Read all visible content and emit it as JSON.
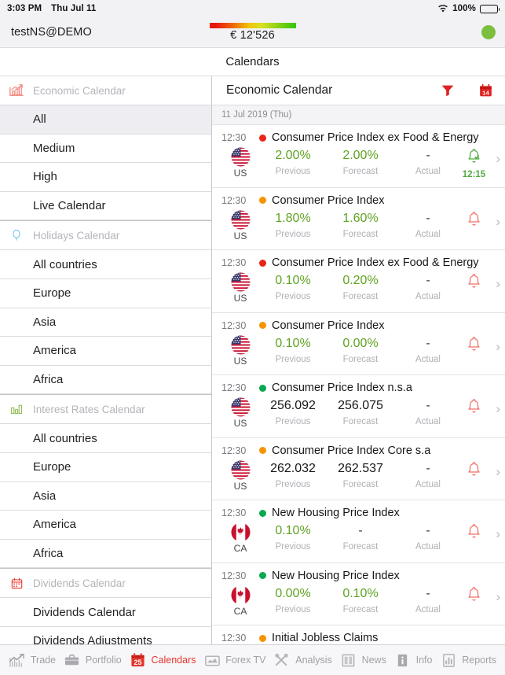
{
  "statusbar": {
    "time": "3:03 PM",
    "date": "Thu Jul 11",
    "battery_pct": "100%",
    "wifi_icon": "wifi-icon",
    "battery_icon": "battery-full-icon"
  },
  "accountbar": {
    "account": "testNS@DEMO",
    "equity": "€ 12'526",
    "equity_bar_icon": "equity-gradient-bar",
    "connection_icon": "connection-status-dot",
    "connection_color": "#7cbf3f"
  },
  "navbar": {
    "title": "Calendars"
  },
  "sidebar": {
    "sections": [
      {
        "label": "Economic Calendar",
        "icon": "economic-chart-icon",
        "icon_color": "#ef8278",
        "items": [
          {
            "label": "All",
            "selected": true
          },
          {
            "label": "Medium",
            "selected": false
          },
          {
            "label": "High",
            "selected": false
          },
          {
            "label": "Live Calendar",
            "selected": false
          }
        ]
      },
      {
        "label": "Holidays Calendar",
        "icon": "balloon-icon",
        "icon_color": "#6fc6ee",
        "items": [
          {
            "label": "All countries",
            "selected": false
          },
          {
            "label": "Europe",
            "selected": false
          },
          {
            "label": "Asia",
            "selected": false
          },
          {
            "label": "America",
            "selected": false
          },
          {
            "label": "Africa",
            "selected": false
          }
        ]
      },
      {
        "label": "Interest Rates Calendar",
        "icon": "bar-chart-icon",
        "icon_color": "#8cb84a",
        "items": [
          {
            "label": "All countries",
            "selected": false
          },
          {
            "label": "Europe",
            "selected": false
          },
          {
            "label": "Asia",
            "selected": false
          },
          {
            "label": "America",
            "selected": false
          },
          {
            "label": "Africa",
            "selected": false
          }
        ]
      },
      {
        "label": "Dividends Calendar",
        "icon": "calendar-icon",
        "icon_color": "#e8342b",
        "items": [
          {
            "label": "Dividends Calendar",
            "selected": false
          },
          {
            "label": "Dividends Adjustments",
            "selected": false
          }
        ]
      }
    ]
  },
  "main": {
    "title": "Economic Calendar",
    "actions": [
      {
        "name": "filter-icon",
        "label": "Filter"
      },
      {
        "name": "calendar-date-icon",
        "label": "14"
      }
    ],
    "date_header": "11 Jul 2019 (Thu)",
    "column_labels": {
      "previous": "Previous",
      "forecast": "Forecast",
      "actual": "Actual"
    },
    "events": [
      {
        "time": "12:30",
        "impact": "high",
        "impact_color": "#e8251a",
        "title": "Consumer Price Index ex Food & Energy",
        "country": "US",
        "flag": "us-flag-icon",
        "previous": "2.00%",
        "previous_style": "green",
        "forecast": "2.00%",
        "forecast_style": "green",
        "actual": "-",
        "actual_style": "dash",
        "bell": "bell-enabled-icon",
        "bell_color": "#4faa3f",
        "bell_time": "12:15"
      },
      {
        "time": "12:30",
        "impact": "medium",
        "impact_color": "#f79300",
        "title": "Consumer Price Index",
        "country": "US",
        "flag": "us-flag-icon",
        "previous": "1.80%",
        "previous_style": "green",
        "forecast": "1.60%",
        "forecast_style": "green",
        "actual": "-",
        "actual_style": "dash",
        "bell": "bell-icon",
        "bell_color": "#ef6e62",
        "bell_time": ""
      },
      {
        "time": "12:30",
        "impact": "high",
        "impact_color": "#e8251a",
        "title": "Consumer Price Index ex Food & Energy",
        "country": "US",
        "flag": "us-flag-icon",
        "previous": "0.10%",
        "previous_style": "green",
        "forecast": "0.20%",
        "forecast_style": "green",
        "actual": "-",
        "actual_style": "dash",
        "bell": "bell-icon",
        "bell_color": "#ef6e62",
        "bell_time": ""
      },
      {
        "time": "12:30",
        "impact": "medium",
        "impact_color": "#f79300",
        "title": "Consumer Price Index",
        "country": "US",
        "flag": "us-flag-icon",
        "previous": "0.10%",
        "previous_style": "green",
        "forecast": "0.00%",
        "forecast_style": "green",
        "actual": "-",
        "actual_style": "dash",
        "bell": "bell-icon",
        "bell_color": "#ef6e62",
        "bell_time": ""
      },
      {
        "time": "12:30",
        "impact": "low",
        "impact_color": "#0aa84f",
        "title": "Consumer Price Index n.s.a",
        "country": "US",
        "flag": "us-flag-icon",
        "previous": "256.092",
        "previous_style": "black",
        "forecast": "256.075",
        "forecast_style": "black",
        "actual": "-",
        "actual_style": "dash",
        "bell": "bell-icon",
        "bell_color": "#ef6e62",
        "bell_time": ""
      },
      {
        "time": "12:30",
        "impact": "medium",
        "impact_color": "#f79300",
        "title": "Consumer Price Index Core s.a",
        "country": "US",
        "flag": "us-flag-icon",
        "previous": "262.032",
        "previous_style": "black",
        "forecast": "262.537",
        "forecast_style": "black",
        "actual": "-",
        "actual_style": "dash",
        "bell": "bell-icon",
        "bell_color": "#ef6e62",
        "bell_time": ""
      },
      {
        "time": "12:30",
        "impact": "low",
        "impact_color": "#0aa84f",
        "title": "New Housing Price Index",
        "country": "CA",
        "flag": "ca-flag-icon",
        "previous": "0.10%",
        "previous_style": "green",
        "forecast": "-",
        "forecast_style": "dash",
        "actual": "-",
        "actual_style": "dash",
        "bell": "bell-icon",
        "bell_color": "#ef6e62",
        "bell_time": ""
      },
      {
        "time": "12:30",
        "impact": "low",
        "impact_color": "#0aa84f",
        "title": "New Housing Price Index",
        "country": "CA",
        "flag": "ca-flag-icon",
        "previous": "0.00%",
        "previous_style": "green",
        "forecast": "0.10%",
        "forecast_style": "green",
        "actual": "-",
        "actual_style": "dash",
        "bell": "bell-icon",
        "bell_color": "#ef6e62",
        "bell_time": ""
      }
    ],
    "partial_event": {
      "time": "12:30",
      "impact": "medium",
      "impact_color": "#f79300",
      "title": "Initial Jobless Claims"
    }
  },
  "tabbar": {
    "items": [
      {
        "label": "Trade",
        "icon": "trade-chart-icon",
        "active": false
      },
      {
        "label": "Portfolio",
        "icon": "briefcase-icon",
        "active": false
      },
      {
        "label": "Calendars",
        "icon": "calendar-25-icon",
        "active": true
      },
      {
        "label": "Forex TV",
        "icon": "tv-icon",
        "active": false
      },
      {
        "label": "Analysis",
        "icon": "tools-icon",
        "active": false
      },
      {
        "label": "News",
        "icon": "newspaper-icon",
        "active": false
      },
      {
        "label": "Info",
        "icon": "info-icon",
        "active": false
      },
      {
        "label": "Reports",
        "icon": "report-bars-icon",
        "active": false
      }
    ],
    "accent_color": "#e8342b"
  }
}
